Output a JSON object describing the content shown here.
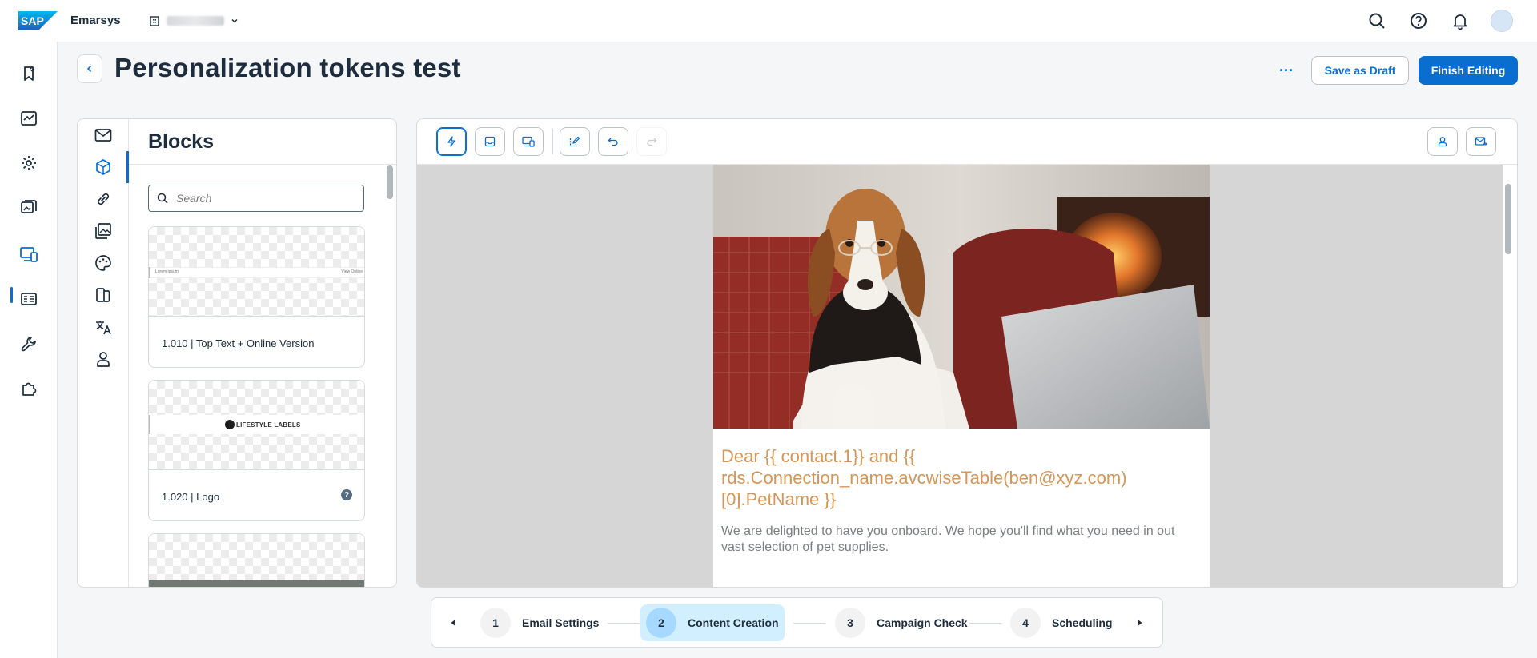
{
  "app": {
    "logo_text": "SAP",
    "product_name": "Emarsys",
    "account_name": ""
  },
  "page": {
    "title": "Personalization tokens test",
    "more_label": "···",
    "save_draft_label": "Save as Draft",
    "finish_label": "Finish Editing"
  },
  "blocks_panel": {
    "title": "Blocks",
    "search_placeholder": "Search",
    "cards": [
      {
        "label": "1.010 | Top Text + Online Version",
        "preview_left": "Lorem ipsum",
        "preview_right": "View Online"
      },
      {
        "label": "1.020 | Logo",
        "preview_logo": "LIFESTYLE LABELS"
      },
      {
        "label": ""
      }
    ]
  },
  "email": {
    "heading": "Dear {{ contact.1}} and {{ rds.Connection_name.avcwiseTable(ben@xyz.com)[0].PetName }}",
    "body": "We are delighted to have you onboard. We hope you'll find what you need in out vast selection of pet supplies."
  },
  "stepper": {
    "steps": [
      {
        "number": "1",
        "label": "Email Settings"
      },
      {
        "number": "2",
        "label": "Content Creation"
      },
      {
        "number": "3",
        "label": "Campaign Check"
      },
      {
        "number": "4",
        "label": "Scheduling"
      }
    ],
    "active_step": 2
  },
  "colors": {
    "accent": "#0a6ed1",
    "heading_orange": "#d69555",
    "active_step_bg": "#d1efff"
  }
}
